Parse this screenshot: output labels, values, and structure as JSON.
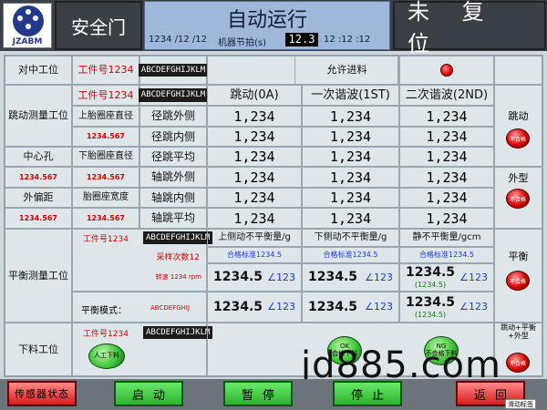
{
  "header": {
    "logo_text": "JZABM",
    "safety_door": "安全门",
    "title": "自动运行",
    "product_code": "1234 /12 /12",
    "cycle_label": "机器节拍(s)",
    "cycle_value": "12.3",
    "clock": "12 :12 :12",
    "reset_status": "未 复 位"
  },
  "top_row": {
    "center_station": "对中工位",
    "work_no": "工件号1234",
    "code": "ABCDEFGHIJKLM",
    "allow_feed": "允许进料"
  },
  "runout_section": {
    "station": "跳动测量工位",
    "work_no": "工件号1234",
    "code": "ABCDEFGHIJKLM",
    "col_headers": [
      "跳动(0A)",
      "一次谐波(1ST)",
      "二次谐波(2ND)"
    ],
    "row_labels": [
      "径跳外侧",
      "径跳内侧",
      "径跳平均",
      "轴跳外侧",
      "轴跳内侧",
      "轴跳平均"
    ],
    "values": [
      [
        "1,234",
        "1,234",
        "1,234"
      ],
      [
        "1,234",
        "1,234",
        "1,234"
      ],
      [
        "1,234",
        "1,234",
        "1,234"
      ],
      [
        "1,234",
        "1,234",
        "1,234"
      ],
      [
        "1,234",
        "1,234",
        "1,234"
      ],
      [
        "1,234",
        "1,234",
        "1,234"
      ]
    ],
    "left_labels": [
      "上胎圈座直径",
      "下胎圈座直径",
      "胎圈座宽度"
    ],
    "left_values": [
      "1234.567",
      "1234.567",
      "1234.567",
      "1234.567",
      "1234.567"
    ],
    "left_titles": [
      "中心孔",
      "外偏距"
    ],
    "side_runout": "跳动",
    "side_shape": "外型",
    "ng": "不合格"
  },
  "balance_section": {
    "station": "平衡测量工位",
    "work_no": "工件号1234",
    "code": "ABCDEFGHIJKLM",
    "sample_count": "采样次数12",
    "speed": "转速 1234 rpm",
    "mode_label": "平衡模式：",
    "mode_value": "ABCDEFGHIJ",
    "col_headers": [
      "上侧动不平衡量/g",
      "下侧动不平衡量/g",
      "静不平衡量/gcm"
    ],
    "std_labels": [
      "合格标准1234.5",
      "合格标准1234.5",
      "合格标准1234.5"
    ],
    "row1": [
      {
        "val": "1234.5",
        "angle": "∠123"
      },
      {
        "val": "1234.5",
        "angle": "∠123"
      },
      {
        "val": "1234.5",
        "sub": "(1234.5)",
        "angle": "∠123"
      }
    ],
    "row2": [
      {
        "val": "1234.5",
        "angle": "∠123"
      },
      {
        "val": "1234.5",
        "angle": "∠123"
      },
      {
        "val": "1234.5",
        "sub": "(1234.5)",
        "angle": "∠123"
      }
    ],
    "side_label": "平衡",
    "ng": "不合格"
  },
  "unload_section": {
    "station": "下料工位",
    "work_no": "工件号1234",
    "code": "ABCDEFGHIJKLM",
    "manual_unload": "人工下料",
    "btn_ok": "OK\n合格下料",
    "btn_ng": "NG\n不合格下料",
    "side_label": "跳动+平衡+外型",
    "ng": "不合格"
  },
  "footer": {
    "sensor": "传感器状态",
    "start": "启动",
    "pause": "暂停",
    "stop": "停止",
    "back": "返回",
    "tooltip": "滑动标签"
  },
  "watermark": "jd885.com"
}
